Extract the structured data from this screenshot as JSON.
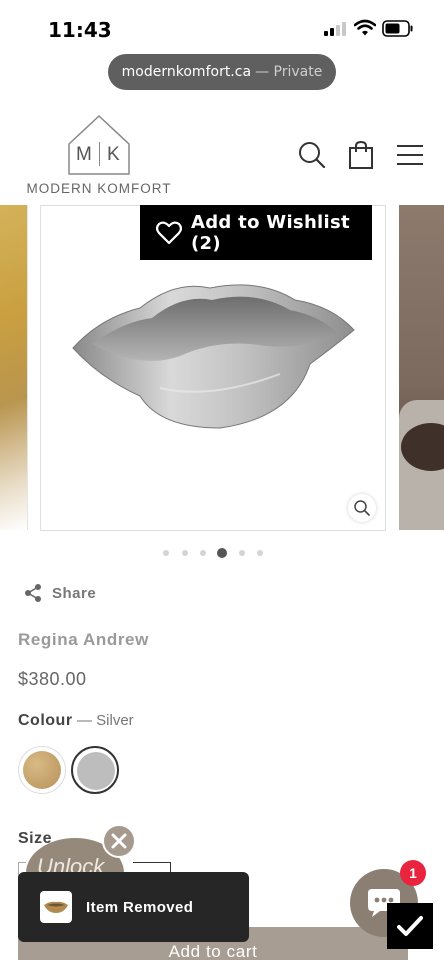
{
  "status_bar": {
    "time": "11:43"
  },
  "browser": {
    "domain": "modernkomfort.ca",
    "mode": "— Private"
  },
  "header": {
    "logo_m": "M",
    "logo_k": "K",
    "logo_text": "MODERN KOMFORT",
    "icons": [
      "search-icon",
      "shopping-bag-icon",
      "menu-icon"
    ]
  },
  "gallery": {
    "wishlist_label": "Add to Wishlist (2)",
    "dot_count": 6,
    "active_dot": 3
  },
  "product": {
    "share_label": "Share",
    "vendor": "Regina Andrew",
    "price": "$380.00",
    "colour_label": "Colour",
    "colour_value": "— Silver",
    "swatches": [
      {
        "name": "Wood",
        "color": "#c8a56e"
      },
      {
        "name": "Silver",
        "color": "#bdbdbd",
        "selected": true
      }
    ],
    "size_label": "Size",
    "add_to_cart": "Add to cart"
  },
  "unlock_widget": {
    "label": "Unlock"
  },
  "toast": {
    "message": "Item Removed"
  },
  "chat": {
    "badge_count": "1"
  },
  "colors": {
    "accent_brown": "#8b7f73",
    "badge_red": "#e8243f",
    "toast_bg": "#262626",
    "wishlist_bg": "#000000"
  }
}
